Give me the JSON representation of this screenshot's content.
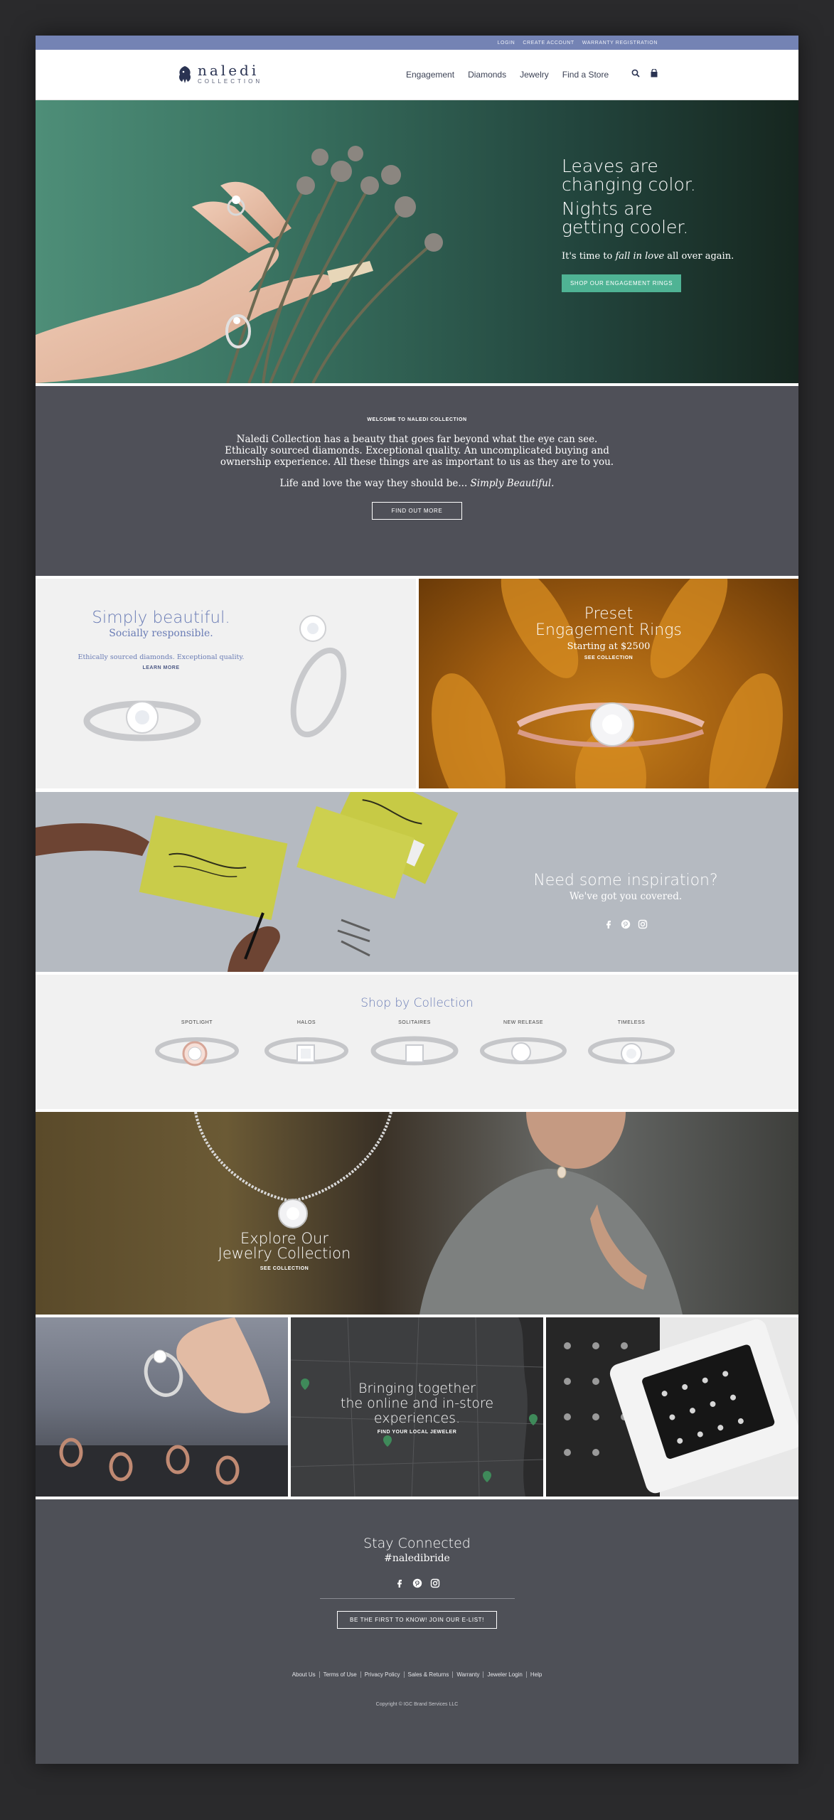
{
  "topbar": {
    "links": [
      "LOGIN",
      "CREATE ACCOUNT",
      "WARRANTY REGISTRATION"
    ]
  },
  "header": {
    "logo_name": "naledi",
    "logo_sub": "COLLECTION",
    "nav": [
      "Engagement",
      "Diamonds",
      "Jewelry",
      "Find a Store"
    ],
    "icons": [
      "search-icon",
      "cart-icon"
    ]
  },
  "hero": {
    "headline_1": "Leaves are changing color.",
    "headline_2": "Nights are getting cooler.",
    "body_pre": "It's time to ",
    "body_em": "fall in love",
    "body_post": " all over again.",
    "cta": "SHOP OUR ENGAGEMENT RINGS",
    "accent": "#4fb394"
  },
  "welcome": {
    "label": "WELCOME TO NALEDI COLLECTION",
    "body": "Naledi Collection has a beauty that goes far beyond what the eye can see. Ethically sourced diamonds. Exceptional quality. An uncomplicated buying and ownership experience. All these things are as important to us as they are to you.",
    "tag_pre": "Life and love the way they should be... ",
    "tag_em": "Simply Beautiful.",
    "cta": "FIND OUT MORE"
  },
  "simply": {
    "title": "Simply beautiful.",
    "subtitle": "Socially responsible.",
    "small": "Ethically sourced diamonds. Exceptional quality.",
    "link": "LEARN MORE"
  },
  "preset": {
    "title_1": "Preset",
    "title_2": "Engagement Rings",
    "price": "Starting at $2500",
    "link": "SEE COLLECTION"
  },
  "inspiration": {
    "title": "Need some inspiration?",
    "subtitle": "We've got you covered.",
    "icons": [
      "facebook-icon",
      "pinterest-icon",
      "instagram-icon"
    ]
  },
  "collection": {
    "title": "Shop by Collection",
    "items": [
      "SPOTLIGHT",
      "HALOS",
      "SOLITAIRES",
      "NEW RELEASE",
      "TIMELESS"
    ]
  },
  "jewelry": {
    "title_1": "Explore Our",
    "title_2": "Jewelry Collection",
    "link": "SEE COLLECTION"
  },
  "bringing": {
    "title_1": "Bringing together",
    "title_2": "the online and in-store",
    "title_3": "experiences.",
    "link": "FIND YOUR LOCAL JEWELER"
  },
  "footer": {
    "title": "Stay Connected",
    "hashtag": "#naledibride",
    "cta": "BE THE FIRST TO KNOW! JOIN OUR E-LIST!",
    "links": [
      "About Us",
      "Terms of Use",
      "Privacy Policy",
      "Sales & Returns",
      "Warranty",
      "Jeweler Login",
      "Help"
    ],
    "copyright": "Copyright © IGC Brand Services LLC"
  }
}
